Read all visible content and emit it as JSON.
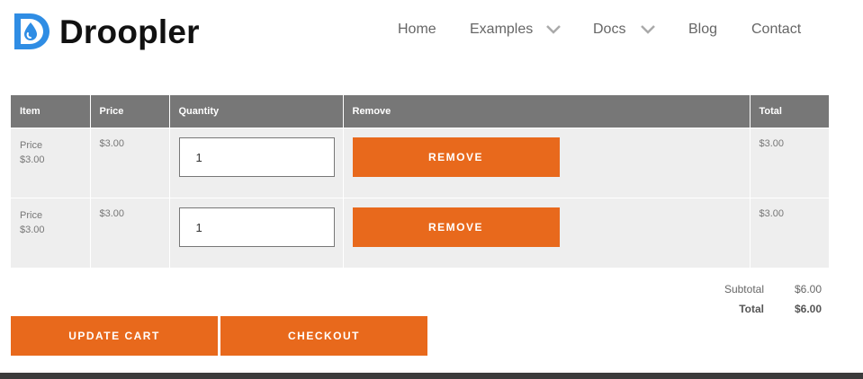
{
  "brand": {
    "name": "Droopler",
    "accent": "#2f8de4"
  },
  "nav": {
    "items": [
      {
        "label": "Home",
        "dropdown": false
      },
      {
        "label": "Examples",
        "dropdown": true
      },
      {
        "label": "Docs",
        "dropdown": true
      },
      {
        "label": "Blog",
        "dropdown": false
      },
      {
        "label": "Contact",
        "dropdown": false
      }
    ]
  },
  "cart": {
    "headers": {
      "item": "Item",
      "price": "Price",
      "quantity": "Quantity",
      "remove": "Remove",
      "total": "Total"
    },
    "rows": [
      {
        "item_label": "Price",
        "item_price": "$3.00",
        "price": "$3.00",
        "quantity": "1",
        "remove_label": "REMOVE",
        "total": "$3.00"
      },
      {
        "item_label": "Price",
        "item_price": "$3.00",
        "price": "$3.00",
        "quantity": "1",
        "remove_label": "REMOVE",
        "total": "$3.00"
      }
    ]
  },
  "totals": {
    "subtotal_label": "Subtotal",
    "subtotal_value": "$6.00",
    "total_label": "Total",
    "total_value": "$6.00"
  },
  "actions": {
    "update_label": "UPDATE CART",
    "checkout_label": "CHECKOUT"
  },
  "colors": {
    "button": "#e8691c",
    "header_row": "#777777",
    "row_bg": "#eeeeee",
    "footer": "#3b3b3b"
  }
}
